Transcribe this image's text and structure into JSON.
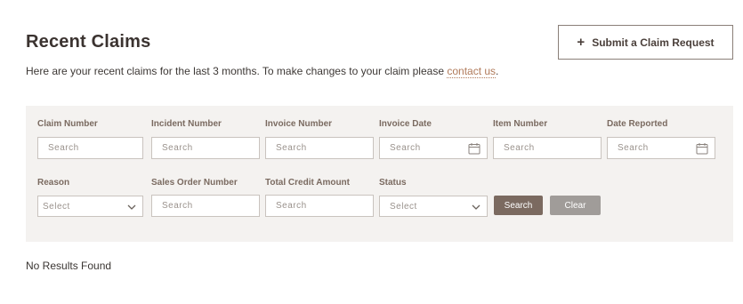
{
  "header": {
    "title": "Recent Claims",
    "subtitle_prefix": "Here are your recent claims for the last 3 months. To make changes to your claim please ",
    "contact_link": "contact us",
    "subtitle_suffix": ".",
    "submit_button": "Submit a Claim Request",
    "submit_icon": "plus-icon"
  },
  "filters": {
    "claim_number": {
      "label": "Claim Number",
      "placeholder": "Search"
    },
    "incident_number": {
      "label": "Incident Number",
      "placeholder": "Search"
    },
    "invoice_number": {
      "label": "Invoice Number",
      "placeholder": "Search"
    },
    "invoice_date": {
      "label": "Invoice Date",
      "placeholder": "Search",
      "icon": "calendar-icon"
    },
    "item_number": {
      "label": "Item Number",
      "placeholder": "Search"
    },
    "date_reported": {
      "label": "Date Reported",
      "placeholder": "Search",
      "icon": "calendar-icon"
    },
    "reason": {
      "label": "Reason",
      "selected": "Select",
      "icon": "chevron-down-icon"
    },
    "sales_order_number": {
      "label": "Sales Order Number",
      "placeholder": "Search"
    },
    "total_credit_amount": {
      "label": "Total Credit Amount",
      "placeholder": "Search"
    },
    "status": {
      "label": "Status",
      "selected": "Select",
      "icon": "chevron-down-icon"
    },
    "search_button": "Search",
    "clear_button": "Clear"
  },
  "results": {
    "empty_message": "No Results Found"
  },
  "colors": {
    "panel_bg": "#f4f2f0",
    "accent_link": "#b07a5a",
    "search_button": "#7b6a60",
    "clear_button": "#a09c99"
  }
}
